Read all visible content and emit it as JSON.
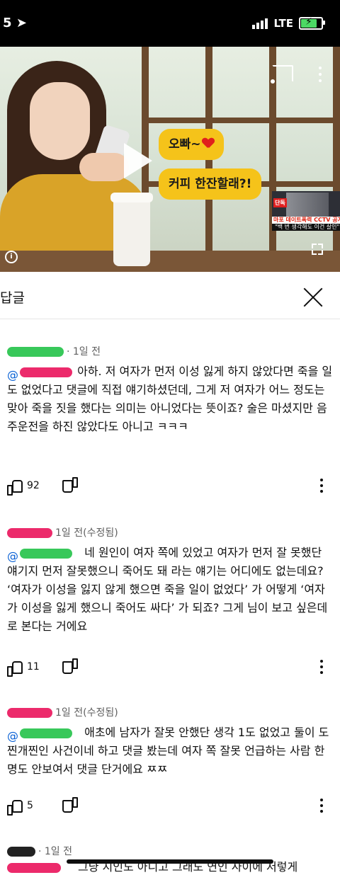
{
  "status_bar": {
    "left": "5",
    "network": "LTE"
  },
  "video": {
    "bubble1": "오빠~",
    "bubble2": "커피 한잔할래?!",
    "thumb_tag": "단독",
    "thumb_caption1": "마포 데이트폭력 CCTV 공개",
    "thumb_caption2": "\"백 번 생각해도 이건 살인\""
  },
  "panel": {
    "title": "답글"
  },
  "comments": [
    {
      "time": "· 1일 전",
      "mention_prefix": "@",
      "text_first": "아하. 저 여자가 먼저 이성 잃게 하지 않았다면",
      "text_rest": "죽을 일도 없었다고 댓글에 직접 얘기하셨던데, 그게 저 여자가 어느 정도는 맞아 죽을 짓을 했다는 의미는 아니었다는 뜻이죠? 술은 마셨지만 음주운전을 하진 않았다도 아니고 ㅋㅋㅋ",
      "likes": "92"
    },
    {
      "time": "1일 전(수정됨)",
      "mention_prefix": "@",
      "text_first": "네 원인이 여자 쪽에 있었고 여자가 먼저 잘",
      "text_rest": "못했단 얘기지 먼저 잘못했으니 죽어도 돼 라는 얘기는 어디에도 없는데요? ‘여자가 이성을 잃지 않게 했으면 죽을 일이 없었다’ 가 어떻게 ‘여자가 이성을 잃게 했으니 죽어도 싸다’ 가 되죠? 그게 님이 보고 싶은데로 본다는 거에요",
      "likes": "11"
    },
    {
      "time": "1일 전(수정됨)",
      "mention_prefix": "@",
      "text_first": "애초에 남자가 잘못 안했단 생각 1도 없었고",
      "text_rest": "둘이 도찐개찐인 사건이네 하고 댓글 봤는데 여자 쪽 잘못 언급하는 사람 한 명도 안보여서 댓글 단거에요 ㅉㅉ",
      "likes": "5"
    },
    {
      "time": "· 1일 전",
      "text_partial": "그냥 지인도 아니고 그래도 연인 사이에 저렇게"
    }
  ]
}
